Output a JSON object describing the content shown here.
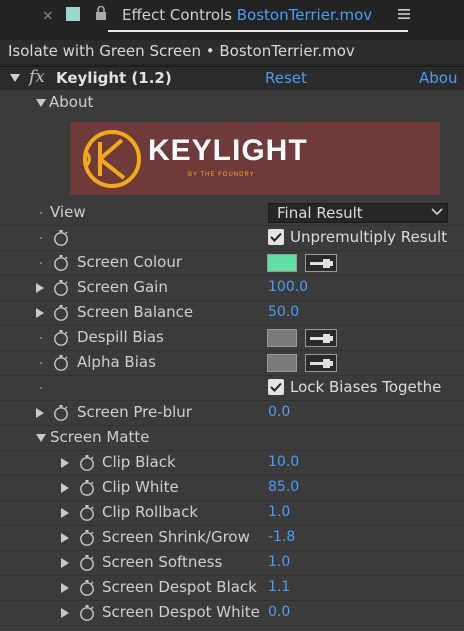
{
  "tab": {
    "close": "×",
    "title_prefix": "Effect Controls",
    "title_file": "BostonTerrier.mov",
    "menu": "≡"
  },
  "header": {
    "text": "Isolate with Green Screen • BostonTerrier.mov"
  },
  "effect": {
    "fx": "fx",
    "name": "Keylight (1.2)",
    "reset": "Reset",
    "about": "Abou"
  },
  "about_group": {
    "label": "About",
    "logo_text": "KEYLIGHT",
    "logo_subtext": "BY THE FOUNDRY"
  },
  "view": {
    "label": "View",
    "selected": "Final Result"
  },
  "unpremultiply": {
    "label": "Unpremultiply Result",
    "checked": true
  },
  "params": {
    "screen_colour": {
      "label": "Screen Colour",
      "color": "#5ee0a0"
    },
    "screen_gain": {
      "label": "Screen Gain",
      "value": "100.0"
    },
    "screen_balance": {
      "label": "Screen Balance",
      "value": "50.0"
    },
    "despill_bias": {
      "label": "Despill Bias",
      "color": "#7a7a7a"
    },
    "alpha_bias": {
      "label": "Alpha Bias",
      "color": "#7a7a7a"
    },
    "lock_biases": {
      "label": "Lock Biases Togethe",
      "checked": true
    },
    "screen_preblur": {
      "label": "Screen Pre-blur",
      "value": "0.0"
    }
  },
  "screen_matte": {
    "label": "Screen Matte",
    "clip_black": {
      "label": "Clip Black",
      "value": "10.0"
    },
    "clip_white": {
      "label": "Clip White",
      "value": "85.0"
    },
    "clip_rollback": {
      "label": "Clip Rollback",
      "value": "1.0"
    },
    "screen_shrink_grow": {
      "label": "Screen Shrink/Grow",
      "value": "-1.8"
    },
    "screen_softness": {
      "label": "Screen Softness",
      "value": "1.0"
    },
    "screen_despot_black": {
      "label": "Screen Despot Black",
      "value": "1.1"
    },
    "screen_despot_white": {
      "label": "Screen Despot White",
      "value": "0.0"
    }
  },
  "colors": {
    "link_blue": "#4e9bf5",
    "logo_orange": "#f2a91a",
    "logo_bg": "#6e3a3a"
  }
}
